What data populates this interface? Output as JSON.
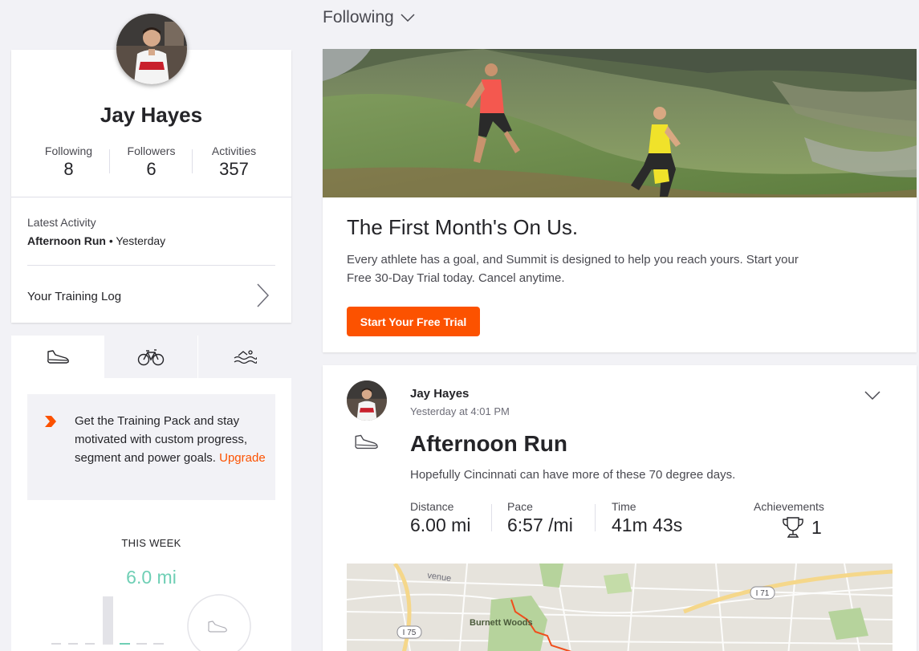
{
  "profile": {
    "name": "Jay Hayes",
    "stats": [
      {
        "label": "Following",
        "value": "8"
      },
      {
        "label": "Followers",
        "value": "6"
      },
      {
        "label": "Activities",
        "value": "357"
      }
    ],
    "latest_activity_label": "Latest Activity",
    "latest_activity_name": "Afternoon Run",
    "latest_activity_when": " • Yesterday",
    "training_log_label": "Your Training Log"
  },
  "sport_tabs": [
    {
      "icon": "run-shoe-icon",
      "active": true
    },
    {
      "icon": "bike-icon",
      "active": false
    },
    {
      "icon": "swim-icon",
      "active": false
    }
  ],
  "training_promo": {
    "text": "Get the Training Pack and stay motivated with custom progress, segment and power goals. ",
    "link": "Upgrade"
  },
  "weekly": {
    "title": "THIS WEEK",
    "distance": "6.0 mi"
  },
  "feed": {
    "filter_label": "Following"
  },
  "hero_promo": {
    "title": "The First Month's On Us.",
    "body": "Every athlete has a goal, and Summit is designed to help you reach yours. Start your Free 30-Day Trial today. Cancel anytime.",
    "cta": "Start Your Free Trial"
  },
  "activity": {
    "athlete": "Jay Hayes",
    "timestamp": "Yesterday at 4:01 PM",
    "title": "Afternoon Run",
    "description": "Hopefully Cincinnati can have more of these 70 degree days.",
    "stats": [
      {
        "label": "Distance",
        "value": "6.00 mi"
      },
      {
        "label": "Pace",
        "value": "6:57 /mi"
      },
      {
        "label": "Time",
        "value": "41m 43s"
      }
    ],
    "achievements_label": "Achievements",
    "achievements_value": "1",
    "map": {
      "street_label": "venue",
      "park_label": "Burnett Woods",
      "highway_a": "I 75",
      "highway_b": "I 71"
    }
  },
  "colors": {
    "brand_orange": "#fc5200",
    "week_accent": "#6fcfb5",
    "background": "#f2f2f6"
  }
}
